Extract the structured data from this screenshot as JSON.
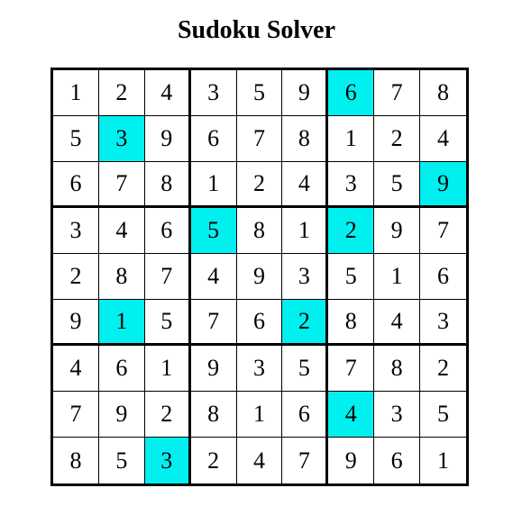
{
  "title": "Sudoku Solver",
  "colors": {
    "highlight": "#00f0f0",
    "grid": "#000000",
    "background": "#ffffff"
  },
  "board": {
    "rows": [
      [
        1,
        2,
        4,
        3,
        5,
        9,
        6,
        7,
        8
      ],
      [
        5,
        3,
        9,
        6,
        7,
        8,
        1,
        2,
        4
      ],
      [
        6,
        7,
        8,
        1,
        2,
        4,
        3,
        5,
        9
      ],
      [
        3,
        4,
        6,
        5,
        8,
        1,
        2,
        9,
        7
      ],
      [
        2,
        8,
        7,
        4,
        9,
        3,
        5,
        1,
        6
      ],
      [
        9,
        1,
        5,
        7,
        6,
        2,
        8,
        4,
        3
      ],
      [
        4,
        6,
        1,
        9,
        3,
        5,
        7,
        8,
        2
      ],
      [
        7,
        9,
        2,
        8,
        1,
        6,
        4,
        3,
        5
      ],
      [
        8,
        5,
        3,
        2,
        4,
        7,
        9,
        6,
        1
      ]
    ],
    "highlighted": [
      [
        0,
        6
      ],
      [
        1,
        1
      ],
      [
        2,
        8
      ],
      [
        3,
        3
      ],
      [
        3,
        6
      ],
      [
        5,
        1
      ],
      [
        5,
        5
      ],
      [
        7,
        6
      ],
      [
        8,
        2
      ]
    ]
  }
}
